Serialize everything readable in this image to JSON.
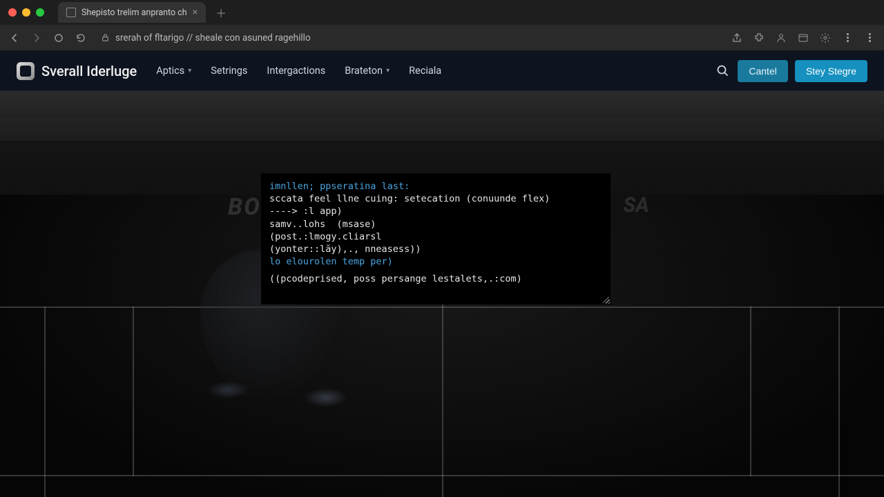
{
  "browser": {
    "tab_title": "Shepisto trelim anpranto ch",
    "url": "srerah of fltarigo // sheale con asuned ragehillo"
  },
  "header": {
    "brand": "Sverall Iderluge",
    "nav": [
      {
        "label": "Aptics",
        "dropdown": true
      },
      {
        "label": "Setrings",
        "dropdown": false
      },
      {
        "label": "Intergactions",
        "dropdown": false
      },
      {
        "label": "Brateton",
        "dropdown": true
      },
      {
        "label": "Reciala",
        "dropdown": false
      }
    ],
    "cancel_label": "Cantel",
    "primary_label": "Stey Stegre"
  },
  "bg": {
    "word_left": "BO",
    "word_right": "SA"
  },
  "code": {
    "l1a": "imnllen; ",
    "l1b": "ppseratina last:",
    "l2": "sccata feel llne cuing: setecation (conuunde flex)",
    "l3": "----> :l app)",
    "l4": "samv..lohs  (msase)",
    "l5": "(post.:lmogy.cliarsl",
    "l6": "(yonter::lăy),., nneasess))",
    "l7": "lo elourolen temp per)",
    "l8": "((pcodeprised, poss persange lestalets,.:com)"
  }
}
